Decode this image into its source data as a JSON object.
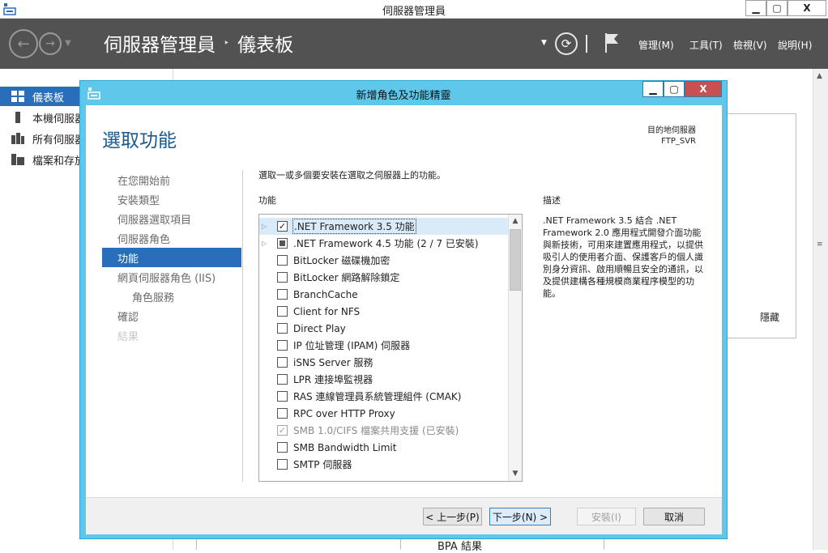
{
  "app": {
    "title": "伺服器管理員",
    "window_buttons": {
      "minimize": "▁",
      "maximize": "▢",
      "close": "X"
    }
  },
  "toolbar": {
    "breadcrumb": [
      "伺服器管理員",
      "儀表板"
    ],
    "breadcrumb_sep": "‣",
    "menus": [
      "管理(M)",
      "工具(T)",
      "檢視(V)",
      "說明(H)"
    ]
  },
  "left_nav": {
    "items": [
      {
        "label": "儀表板",
        "active": true
      },
      {
        "label": "本機伺服器",
        "active": false
      },
      {
        "label": "所有伺服器",
        "active": false
      },
      {
        "label": "檔案和存放",
        "active": false
      }
    ]
  },
  "dashboard": {
    "hide_label": "隱藏",
    "bpa_label": "BPA 結果"
  },
  "wizard": {
    "title": "新增角色及功能精靈",
    "heading": "選取功能",
    "destination_label": "目的地伺服器",
    "destination_server": "FTP_SVR",
    "steps": [
      {
        "label": "在您開始前",
        "state": "normal"
      },
      {
        "label": "安裝類型",
        "state": "normal"
      },
      {
        "label": "伺服器選取項目",
        "state": "normal"
      },
      {
        "label": "伺服器角色",
        "state": "normal"
      },
      {
        "label": "功能",
        "state": "active"
      },
      {
        "label": "網頁伺服器角色 (IIS)",
        "state": "normal"
      },
      {
        "label": "角色服務",
        "state": "sub"
      },
      {
        "label": "確認",
        "state": "normal"
      },
      {
        "label": "結果",
        "state": "disabled"
      }
    ],
    "instruction": "選取一或多個要安裝在選取之伺服器上的功能。",
    "features_header": "功能",
    "description_header": "描述",
    "description": ".NET Framework 3.5 結合 .NET Framework 2.0 應用程式開發介面功能與新技術，可用來建置應用程式，以提供吸引人的使用者介面、保護客戶的個人識別身分資訊、啟用順暢且安全的通訊，以及提供建構各種規模商業程序模型的功能。",
    "features": [
      {
        "label": ".NET Framework 3.5 功能",
        "expandable": true,
        "state": "checked",
        "selected": true
      },
      {
        "label": ".NET Framework 4.5 功能 (2 / 7 已安裝)",
        "expandable": true,
        "state": "partial",
        "selected": false
      },
      {
        "label": "BitLocker 磁碟機加密",
        "expandable": false,
        "state": "unchecked"
      },
      {
        "label": "BitLocker 網路解除鎖定",
        "expandable": false,
        "state": "unchecked"
      },
      {
        "label": "BranchCache",
        "expandable": false,
        "state": "unchecked"
      },
      {
        "label": "Client for NFS",
        "expandable": false,
        "state": "unchecked"
      },
      {
        "label": "Direct Play",
        "expandable": false,
        "state": "unchecked"
      },
      {
        "label": "IP 位址管理 (IPAM) 伺服器",
        "expandable": false,
        "state": "unchecked"
      },
      {
        "label": "iSNS Server 服務",
        "expandable": false,
        "state": "unchecked"
      },
      {
        "label": "LPR 連接埠監視器",
        "expandable": false,
        "state": "unchecked"
      },
      {
        "label": "RAS 連線管理員系統管理組件 (CMAK)",
        "expandable": false,
        "state": "unchecked"
      },
      {
        "label": "RPC over HTTP Proxy",
        "expandable": false,
        "state": "unchecked"
      },
      {
        "label": "SMB 1.0/CIFS 檔案共用支援 (已安裝)",
        "expandable": false,
        "state": "installed"
      },
      {
        "label": "SMB Bandwidth Limit",
        "expandable": false,
        "state": "unchecked"
      },
      {
        "label": "SMTP 伺服器",
        "expandable": false,
        "state": "unchecked"
      }
    ],
    "buttons": {
      "prev": "< 上一步(P)",
      "next": "下一步(N) >",
      "install": "安裝(I)",
      "cancel": "取消"
    }
  },
  "colors": {
    "accent": "#2a6ebb",
    "toolbar_bg": "#525252",
    "wizard_frame": "#5ec7ea",
    "close_red": "#c75050",
    "heading_blue": "#1c5a8c"
  }
}
